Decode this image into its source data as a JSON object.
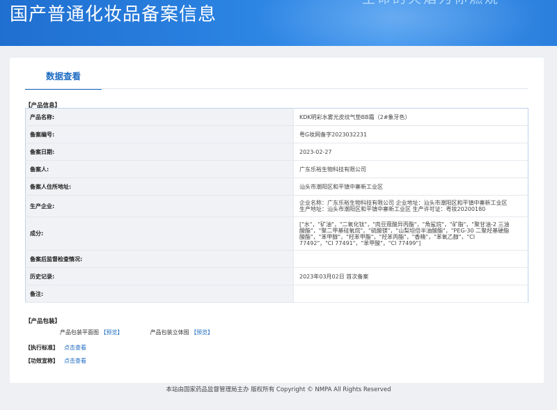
{
  "header": {
    "title": "国产普通化妆品备案信息",
    "slogan": "生命的火焰为你燃烧"
  },
  "tabs": [
    {
      "label": "数据查看"
    }
  ],
  "product_info": {
    "section_label": "【产品信息】",
    "rows": [
      {
        "label": "产品名称:",
        "value": "KDK明彩水雾光皮纹气垫BB霜（2#象牙色）"
      },
      {
        "label": "备案编号:",
        "value": "粤G妆网备字2023032231"
      },
      {
        "label": "备案日期:",
        "value": "2023-02-27"
      },
      {
        "label": "备案人:",
        "value": "广东乐裕生物科技有限公司"
      },
      {
        "label": "备案人住所地址:",
        "value": "汕头市潮阳区和平镇中寨新工业区"
      },
      {
        "label": "生产企业:",
        "value": "企业名称：广东乐裕生物科技有限公司 企业地址：汕头市潮阳区和平镇中寨新工业区 生产地址：汕头市潮阳区和平镇中寨新工业区 生产许可证：粤妆20200180"
      },
      {
        "label": "成分:",
        "value": "[\"水\"，\"矿油\"，\"二氧化钛\"，\"肉豆蔻酸异丙酯\"，\"角鲨烷\"，\"矿脂\"，\"聚甘油-2 三油酸酯\"，\"聚二甲基硅氧烷\"，\"硫酸镁\"，\"山梨坦倍半油酸酯\"，\"PEG-30 二聚羟基硬脂酸酯\"，\"苯甲醇\"，\"羟苯甲酯\"，\"羟苯丙酯\"，\"香精\"，\"苯氧乙醇\"，\"CI 77492\"，\"CI 77491\"，\"苯甲酸\"，\"CI 77499\"]"
      },
      {
        "label": "备案后监督检查情况:",
        "value": ""
      },
      {
        "label": "历史记录:",
        "value": "2023年03月02日 首次备案"
      },
      {
        "label": "备注:",
        "value": ""
      }
    ]
  },
  "packaging": {
    "section_label": "【产品包装】",
    "flat_label": "产品包装平面图",
    "flat_link": "【预览】",
    "solid_label": "产品包装立体图",
    "solid_link": "【预览】"
  },
  "standard": {
    "label": "【执行标准】",
    "link": "点击查看"
  },
  "efficacy": {
    "label": "【功效宣称】",
    "link": "点击查看"
  },
  "footer": {
    "text": "本站由国家药品监督管理局主办 版权所有 Copyright © NMPA All Rights Reserved"
  }
}
